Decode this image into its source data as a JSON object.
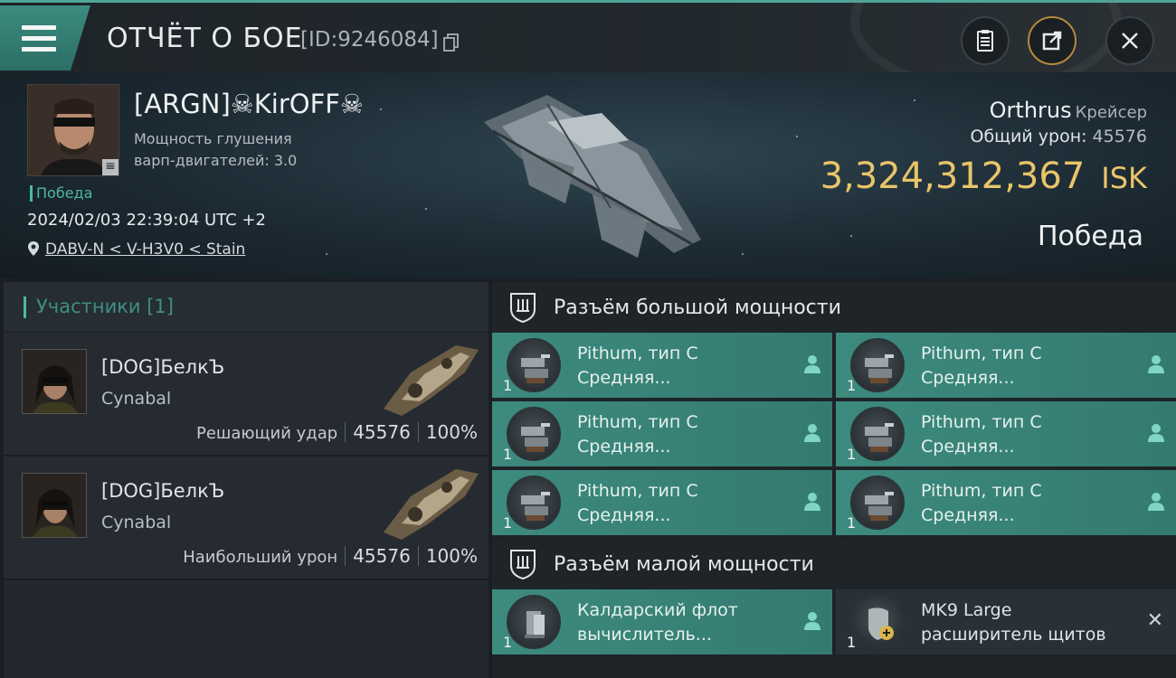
{
  "header": {
    "title": "ОТЧЁТ О БОЕ",
    "report_id": "[ID:9246084]"
  },
  "victim": {
    "name": "[ARGN]☠KirOFF☠",
    "warp_label": "Мощность глушения",
    "warp_value": "варп-двигателей: 3.0",
    "status": "Победа",
    "datetime": "2024/02/03 22:39:04 UTC +2",
    "location": "DABV-N < V-H3V0 < Stain",
    "ship": "Orthrus",
    "ship_class": "Крейсер",
    "damage_label": "Общий урон:",
    "damage_value": "45576",
    "isk_value": "3,324,312,367",
    "isk_unit": "ISK",
    "result": "Победа"
  },
  "participants": {
    "title": "Участники [1]",
    "items": [
      {
        "name": "[DOG]БелкЪ",
        "ship": "Cynabal",
        "role": "Решающий удар",
        "damage": "45576",
        "percent": "100%"
      },
      {
        "name": "[DOG]БелкЪ",
        "ship": "Cynabal",
        "role": "Наибольший урон",
        "damage": "45576",
        "percent": "100%"
      }
    ]
  },
  "high_slots": {
    "title": "Разъём большой мощности",
    "modules": [
      {
        "line1": "Pithum, тип C",
        "line2": "Средняя...",
        "qty": "1"
      },
      {
        "line1": "Pithum, тип C",
        "line2": "Средняя...",
        "qty": "1"
      },
      {
        "line1": "Pithum, тип C",
        "line2": "Средняя...",
        "qty": "1"
      },
      {
        "line1": "Pithum, тип C",
        "line2": "Средняя...",
        "qty": "1"
      },
      {
        "line1": "Pithum, тип C",
        "line2": "Средняя...",
        "qty": "1"
      },
      {
        "line1": "Pithum, тип C",
        "line2": "Средняя...",
        "qty": "1"
      }
    ]
  },
  "low_slots": {
    "title": "Разъём малой мощности",
    "modules": [
      {
        "line1": "Калдарский флот",
        "line2": "вычислитель...",
        "qty": "1"
      },
      {
        "line1": "MK9 Large",
        "line2": "расширитель щитов",
        "qty": "1"
      }
    ]
  },
  "colors": {
    "accent": "#4fb8a0",
    "module_bg": "#3d8a7e",
    "isk": "#e9c46a"
  },
  "icons": [
    "menu-icon",
    "copy-icon",
    "clipboard-icon",
    "share-icon",
    "close-icon",
    "location-pin-icon",
    "shield-slot-icon",
    "person-icon",
    "turret-icon"
  ]
}
